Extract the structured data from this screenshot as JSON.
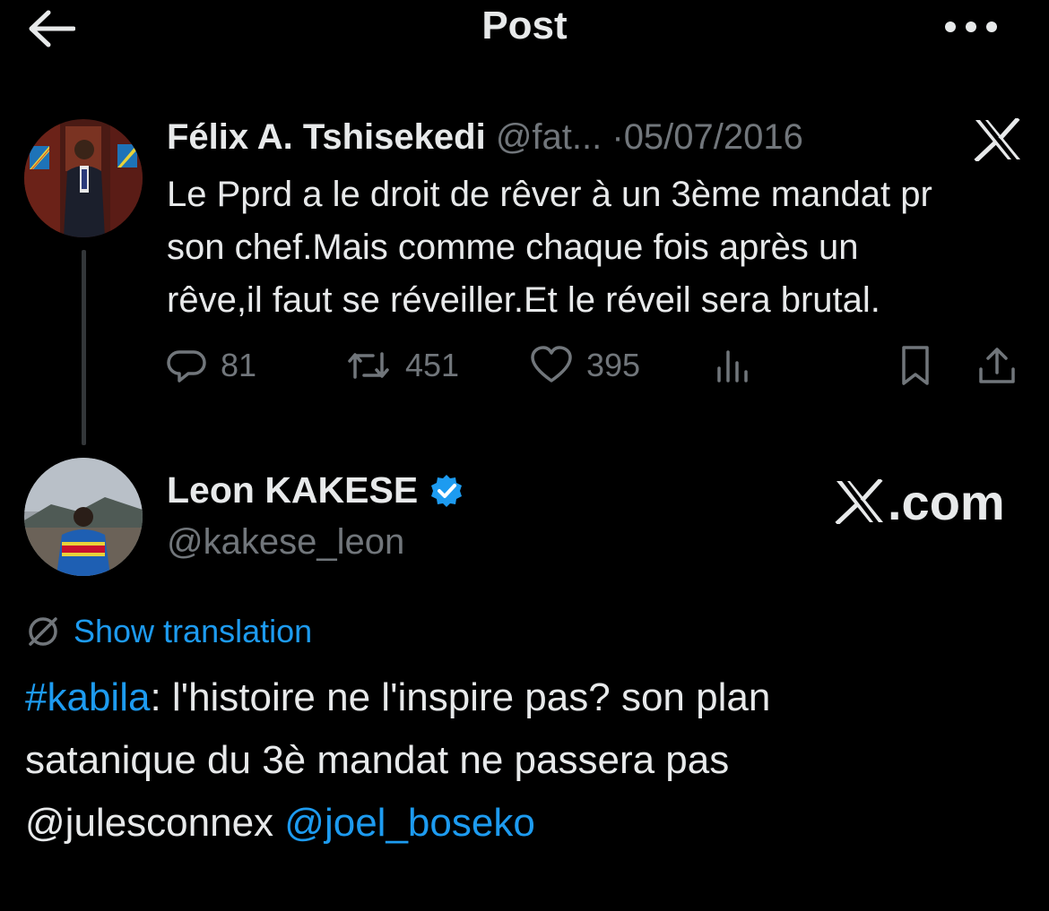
{
  "header": {
    "title": "Post"
  },
  "quoted_tweet": {
    "author_name": "Félix A. Tshisekedi",
    "handle": "@fat...",
    "separator": "·",
    "date": "05/07/2016",
    "text_lines": [
      "Le Pprd a le droit de rêver à un 3ème mandat pr",
      "son chef.Mais comme chaque fois après un",
      "rêve,il faut se réveiller.Et le réveil sera brutal."
    ],
    "replies": "81",
    "reposts": "451",
    "likes": "395"
  },
  "main_tweet": {
    "author_name": "Leon KAKESE",
    "handle": "@kakese_leon",
    "watermark": ".com",
    "translate_label": "Show translation",
    "hashtag": "#kabila",
    "text_part1": ": l'histoire ne l'inspire pas? son plan",
    "text_line2": "satanique du 3è mandat ne passera pas",
    "mention1": "@julesconnex",
    "mention2": "@joel_boseko"
  },
  "colors": {
    "background": "#000000",
    "text": "#e7e9ea",
    "muted": "#71767b",
    "accent": "#1d9bf0"
  },
  "icons": [
    "back-arrow-icon",
    "more-icon",
    "x-logo-icon",
    "reply-icon",
    "repost-icon",
    "like-icon",
    "views-icon",
    "bookmark-icon",
    "share-icon",
    "verified-badge-icon",
    "translate-icon"
  ]
}
